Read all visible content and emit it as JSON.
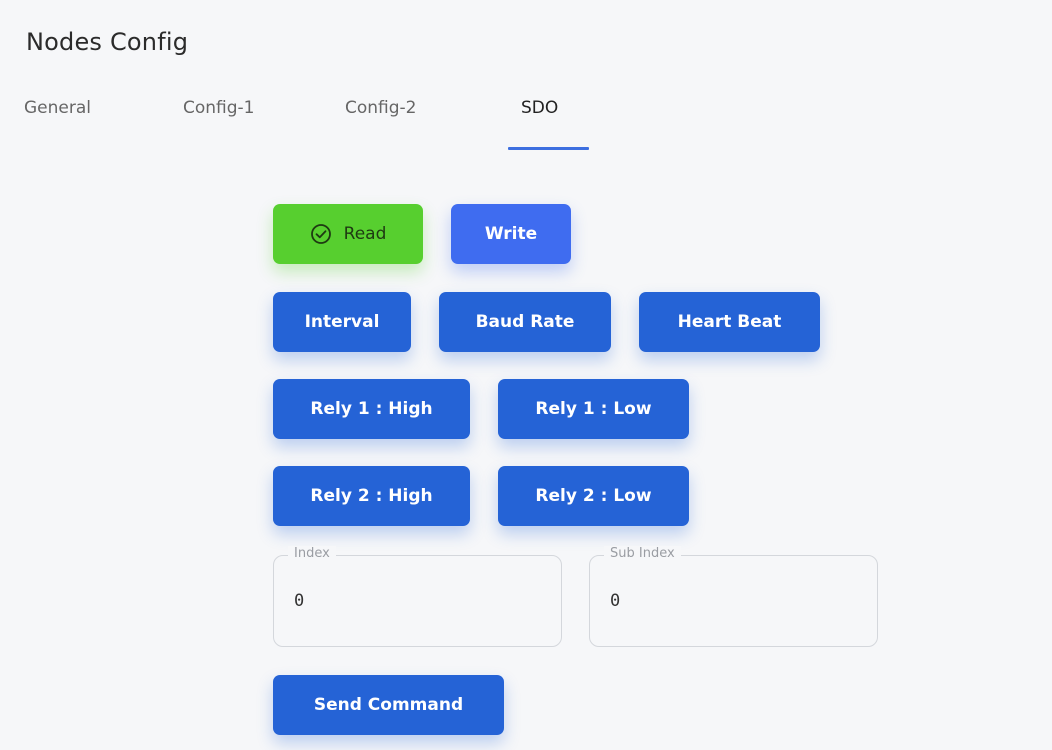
{
  "header": {
    "title": "Nodes Config"
  },
  "tabs": [
    {
      "label": "General",
      "active": false
    },
    {
      "label": "Config-1",
      "active": false
    },
    {
      "label": "Config-2",
      "active": false
    },
    {
      "label": "SDO",
      "active": true
    }
  ],
  "mode_buttons": {
    "read_label": "Read",
    "write_label": "Write",
    "selected": "Read"
  },
  "param_buttons": {
    "interval": "Interval",
    "baud_rate": "Baud Rate",
    "heart_beat": "Heart Beat"
  },
  "relay_buttons": {
    "rely1_high": "Rely 1 : High",
    "rely1_low": "Rely 1 : Low",
    "rely2_high": "Rely 2 : High",
    "rely2_low": "Rely 2 : Low"
  },
  "fields": {
    "index": {
      "label": "Index",
      "value": "0"
    },
    "sub_index": {
      "label": "Sub Index",
      "value": "0"
    }
  },
  "actions": {
    "send_command": "Send Command"
  },
  "colors": {
    "background": "#f6f7f9",
    "primary_button": "#2563d6",
    "write_button": "#3f6cf0",
    "read_button_selected": "#57cf2f",
    "tab_indicator": "#3d6fe0"
  },
  "icons": {
    "read_icon": "check-circle-icon"
  }
}
